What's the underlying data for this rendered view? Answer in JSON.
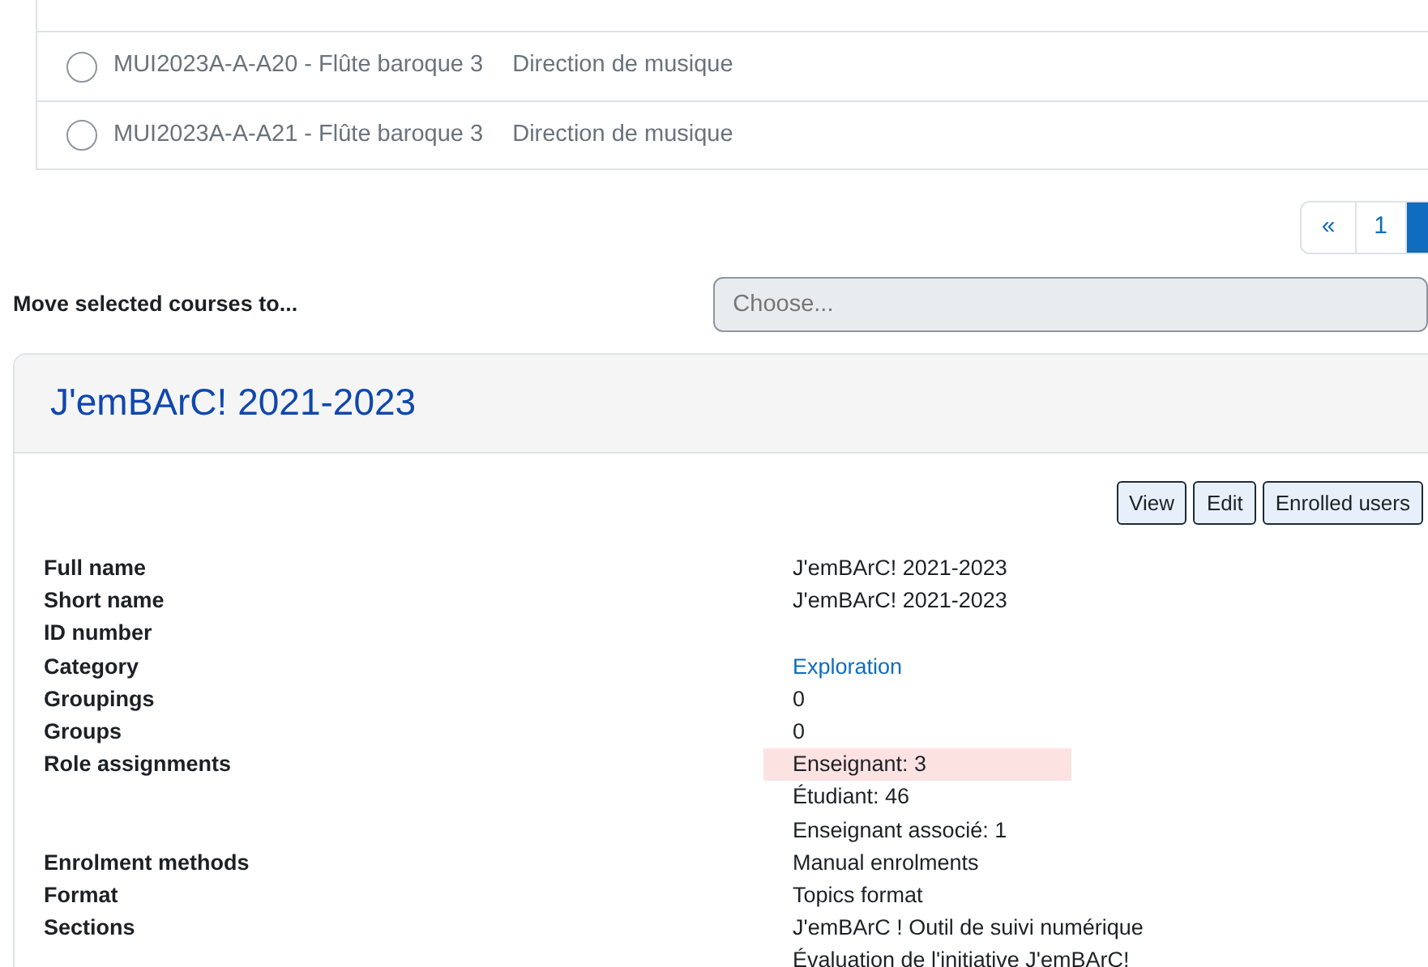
{
  "course_list": [
    {
      "label": "MUI2023A-A-A20 - Flûte baroque 3",
      "category": "Direction de musique",
      "selected": false
    },
    {
      "label": "MUI2023A-A-A21 - Flûte baroque 3",
      "category": "Direction de musique",
      "selected": false
    }
  ],
  "pagination": [
    {
      "label": "«",
      "selected": false
    },
    {
      "label": "1",
      "selected": false
    },
    {
      "selected": true
    }
  ],
  "move": {
    "label": "Move selected courses to...",
    "placeholder": "Choose..."
  },
  "course": {
    "title": "J'emBArC! 2021-2023",
    "buttons": [
      "View",
      "Edit",
      "Enrolled users"
    ],
    "details": [
      {
        "label": "Full name",
        "values": [
          {
            "text": "J'emBArC! 2021-2023",
            "kind": "text",
            "highlighted": false
          }
        ]
      },
      {
        "label": "Short name",
        "values": [
          {
            "text": "J'emBArC! 2021-2023",
            "kind": "text",
            "highlighted": false
          }
        ]
      },
      {
        "label": "ID number"
      },
      {
        "label": "Category",
        "values": [
          {
            "text": "Exploration",
            "kind": "link",
            "highlighted": false
          }
        ]
      },
      {
        "label": "Groupings",
        "values": [
          {
            "text": "0",
            "kind": "text",
            "highlighted": false
          }
        ]
      },
      {
        "label": "Groups",
        "values": [
          {
            "text": "0",
            "kind": "text",
            "highlighted": false
          }
        ]
      },
      {
        "label": "Role assignments",
        "values": [
          {
            "text": "Enseignant: 3",
            "kind": "text",
            "highlighted": true
          },
          {
            "text": "Étudiant: 46",
            "kind": "text",
            "highlighted": false
          },
          {
            "text": "Enseignant associé: 1",
            "kind": "text",
            "highlighted": false
          }
        ]
      },
      {
        "label": "Enrolment methods",
        "values": [
          {
            "text": "Manual enrolments",
            "kind": "text",
            "highlighted": false
          }
        ]
      },
      {
        "label": "Format",
        "values": [
          {
            "text": "Topics format",
            "kind": "text",
            "highlighted": false
          }
        ]
      },
      {
        "label": "Sections",
        "values": [
          {
            "text": "J'emBArC ! Outil de suivi numérique",
            "kind": "text",
            "highlighted": false
          },
          {
            "text": "Évaluation de l'initiative J'emBArC!",
            "kind": "text",
            "highlighted": false
          }
        ]
      }
    ]
  }
}
